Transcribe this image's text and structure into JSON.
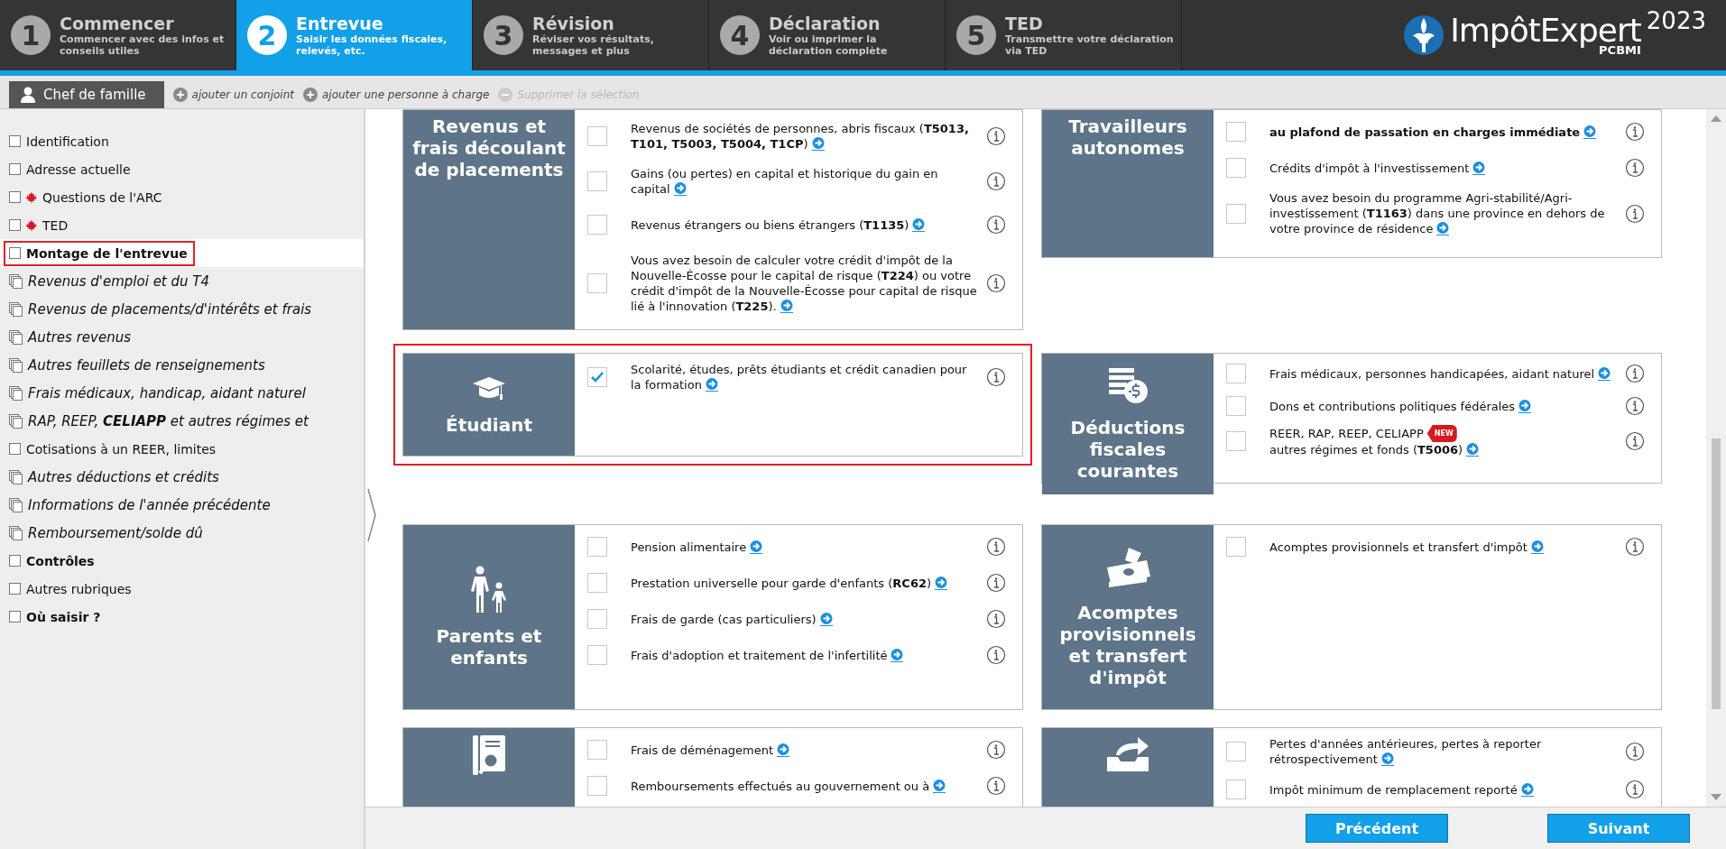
{
  "steps": [
    {
      "number": "1",
      "title": "Commencer",
      "subtitle": "Commencer avec des infos et conseils utiles",
      "selected": false
    },
    {
      "number": "2",
      "title": "Entrevue",
      "subtitle": "Saisir les données fiscales, relevés, etc.",
      "selected": true
    },
    {
      "number": "3",
      "title": "Révision",
      "subtitle": "Réviser vos résultats, messages et plus",
      "selected": false
    },
    {
      "number": "4",
      "title": "Déclaration",
      "subtitle": "Voir ou imprimer la déclaration complète",
      "selected": false
    },
    {
      "number": "5",
      "title": "TED",
      "subtitle": "Transmettre votre déclaration via TED",
      "selected": false
    }
  ],
  "logo": {
    "name": "ImpôtExpert",
    "year": "2023",
    "sub": "PCBMI"
  },
  "person_bar": {
    "current": "Chef de famille",
    "actions": [
      {
        "label": "ajouter un conjoint",
        "disabled": false
      },
      {
        "label": "ajouter une personne à charge",
        "disabled": false
      },
      {
        "label": "Supprimer la sélection",
        "disabled": true
      }
    ]
  },
  "sidebar": {
    "items": [
      {
        "label": "Identification",
        "kind": "plain",
        "flag": false,
        "selected": false
      },
      {
        "label": "Adresse actuelle",
        "kind": "plain",
        "flag": false,
        "selected": false
      },
      {
        "label": "Questions de l'ARC",
        "kind": "plain",
        "flag": true,
        "selected": false
      },
      {
        "label": "TED",
        "kind": "plain",
        "flag": true,
        "selected": false
      },
      {
        "label": "Montage de l'entrevue",
        "kind": "bold",
        "flag": false,
        "selected": true
      },
      {
        "label": "Revenus d'emploi et du T4",
        "kind": "form",
        "flag": false,
        "selected": false
      },
      {
        "label": "Revenus de placements/d'intérêts et frais",
        "kind": "form",
        "flag": false,
        "selected": false
      },
      {
        "label": "Autres revenus",
        "kind": "form",
        "flag": false,
        "selected": false
      },
      {
        "label": "Autres feuillets de renseignements",
        "kind": "form",
        "flag": false,
        "selected": false
      },
      {
        "label": "Frais médicaux, handicap, aidant naturel",
        "kind": "form",
        "flag": false,
        "selected": false
      },
      {
        "label": "RAP, REEP, **CELIAPP** et autres régimes et",
        "kind": "form",
        "flag": false,
        "selected": false
      },
      {
        "label": "Cotisations à un REER, limites",
        "kind": "plain",
        "flag": false,
        "selected": false
      },
      {
        "label": "Autres déductions et crédits",
        "kind": "form",
        "flag": false,
        "selected": false
      },
      {
        "label": "Informations de l'année précédente",
        "kind": "form",
        "flag": false,
        "selected": false
      },
      {
        "label": "Remboursement/solde dû",
        "kind": "form",
        "flag": false,
        "selected": false
      },
      {
        "label": "Contrôles",
        "kind": "bold",
        "flag": false,
        "selected": false
      },
      {
        "label": "Autres rubriques",
        "kind": "plain",
        "flag": false,
        "selected": false
      },
      {
        "label": "Où saisir ?",
        "kind": "bold",
        "flag": false,
        "selected": false
      }
    ]
  },
  "cards": [
    {
      "title": "Revenus et frais découlant de placements",
      "kind": "text",
      "highlighted": false,
      "items": [
        {
          "text": "Revenus de sociétés de personnes, abris fiscaux (**T5013, T101, T5003, T5004, T1CP**)",
          "checked": false
        },
        {
          "text": "Gains (ou pertes) en capital et historique du gain en capital",
          "checked": false
        },
        {
          "text": "Revenus étrangers ou biens étrangers (**T1135**)",
          "checked": false
        },
        {
          "text": "Vous avez besoin de calculer votre crédit d'impôt de la Nouvelle-Écosse pour le capital de risque (**T224**) ou votre crédit d'impôt de la Nouvelle-Écosse pour capital de risque lié à l'innovation (**T225**).",
          "checked": false
        }
      ]
    },
    {
      "title": "Travailleurs autonomes",
      "kind": "text",
      "highlighted": false,
      "items": [
        {
          "text": "**au plafond de passation en charges immédiate**",
          "checked": false
        },
        {
          "text": "Crédits d'impôt à l'investissement",
          "checked": false
        },
        {
          "text": "Vous avez besoin du programme Agri-stabilité/Agri-investissement (**T1163**) dans une province en dehors de votre province de résidence",
          "checked": false
        }
      ]
    },
    {
      "title": "Étudiant",
      "kind": "cap",
      "highlighted": true,
      "items": [
        {
          "text": "Scolarité, études, prêts étudiants et crédit canadien pour la formation",
          "checked": true
        }
      ]
    },
    {
      "title": "Déductions fiscales courantes",
      "kind": "coins",
      "highlighted": false,
      "items": [
        {
          "text": "Frais médicaux, personnes handicapées, aidant naturel",
          "checked": false
        },
        {
          "text": "Dons et contributions politiques fédérales",
          "checked": false
        },
        {
          "text": "REER, RAP, REEP, CELIAPP",
          "badge": "NEW",
          "text2": "autres régimes et fonds (**T5006**)",
          "checked": false
        }
      ]
    },
    {
      "title": "Parents et enfants",
      "kind": "family",
      "highlighted": false,
      "items": [
        {
          "text": "Pension alimentaire",
          "checked": false
        },
        {
          "text": "Prestation universelle pour garde d'enfants (**RC62**)",
          "checked": false
        },
        {
          "text": "Frais de garde (cas particuliers)",
          "checked": false
        },
        {
          "text": "Frais d'adoption et traitement de l'infertilité",
          "checked": false
        }
      ]
    },
    {
      "title": "Acomptes provisionnels et transfert d'impôt",
      "kind": "money",
      "highlighted": false,
      "items": [
        {
          "text": "Acomptes provisionnels et transfert d'impôt",
          "checked": false
        }
      ]
    },
    {
      "kind": "document",
      "highlighted": false,
      "items": [
        {
          "text": "Frais de déménagement",
          "checked": false
        },
        {
          "text": "Remboursements effectués au gouvernement ou à",
          "checked": false
        }
      ]
    },
    {
      "kind": "tray",
      "highlighted": false,
      "items": [
        {
          "text": "Pertes d'années antérieures, pertes à reporter rétrospectivement",
          "checked": false
        },
        {
          "text": "Impôt minimum de remplacement reporté",
          "checked": false
        }
      ]
    }
  ],
  "buttons": [
    {
      "label": "Précédent"
    },
    {
      "label": "Suivant"
    }
  ]
}
